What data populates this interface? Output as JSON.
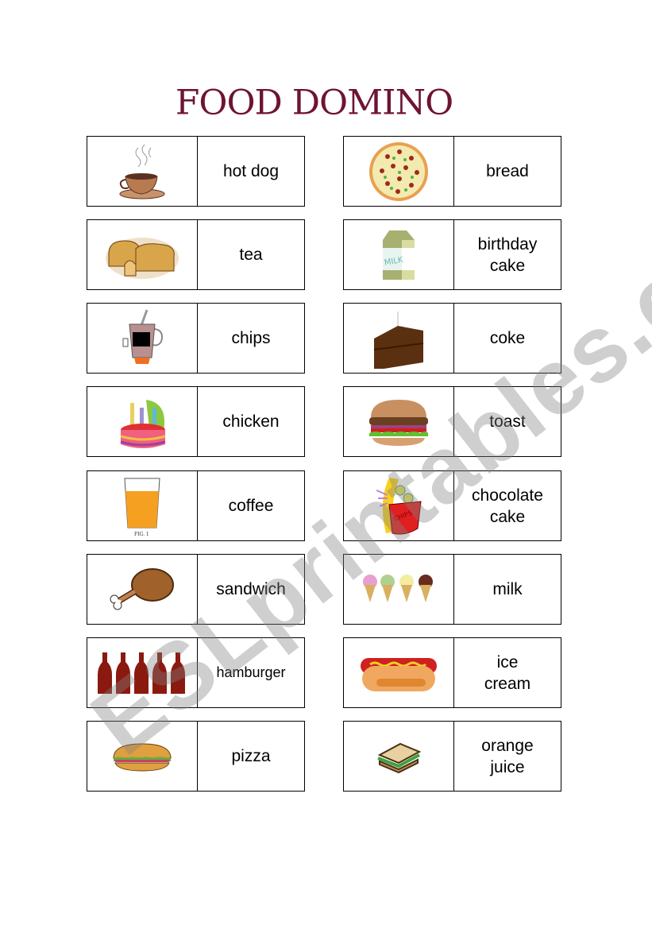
{
  "title": "FOOD DOMINO",
  "watermark": "ESLprintables.com",
  "colors": {
    "title": "#6e1432",
    "border": "#000000"
  },
  "dominoes": [
    {
      "picture": "coffee-cup",
      "word": "hot dog"
    },
    {
      "picture": "pizza",
      "word": "bread"
    },
    {
      "picture": "bread-loaves",
      "word": "tea"
    },
    {
      "picture": "milk-carton",
      "word": "birthday\ncake"
    },
    {
      "picture": "tea-mug",
      "word": "chips"
    },
    {
      "picture": "chocolate-cake-slice",
      "word": "coke"
    },
    {
      "picture": "birthday-cake",
      "word": "chicken"
    },
    {
      "picture": "hamburger",
      "word": "toast"
    },
    {
      "picture": "orange-juice-glass",
      "word": "coffee"
    },
    {
      "picture": "chips-bag",
      "word": "chocolate\ncake"
    },
    {
      "picture": "chicken-leg",
      "word": "sandwich"
    },
    {
      "picture": "ice-cream-cones",
      "word": "milk"
    },
    {
      "picture": "coke-bottles",
      "word": "hamburger"
    },
    {
      "picture": "hot-dog",
      "word": "ice\ncream"
    },
    {
      "picture": "sub-sandwich",
      "word": "pizza"
    },
    {
      "picture": "sandwich",
      "word": "orange\njuice"
    }
  ]
}
